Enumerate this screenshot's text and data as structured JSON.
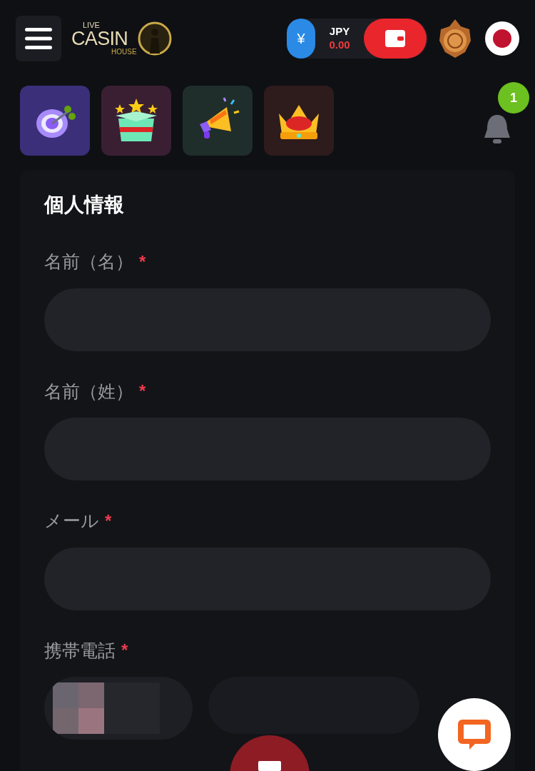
{
  "header": {
    "logo": {
      "top": "LIVE",
      "main": "CASIN",
      "bottom": "HOUSE"
    },
    "balance": {
      "symbol": "¥",
      "currency": "JPY",
      "amount": "0.00"
    }
  },
  "promos": [
    {
      "kind": "target"
    },
    {
      "kind": "gift"
    },
    {
      "kind": "megaphone"
    },
    {
      "kind": "crown"
    }
  ],
  "notifications": {
    "count": "1"
  },
  "form": {
    "title": "個人情報",
    "fields": [
      {
        "label": "名前（名）",
        "required_mark": "*",
        "kind": "text"
      },
      {
        "label": "名前（姓）",
        "required_mark": "*",
        "kind": "text"
      },
      {
        "label": "メール",
        "required_mark": "*",
        "kind": "text"
      },
      {
        "label": "携帯電話",
        "required_mark": "*",
        "kind": "phone"
      }
    ]
  }
}
